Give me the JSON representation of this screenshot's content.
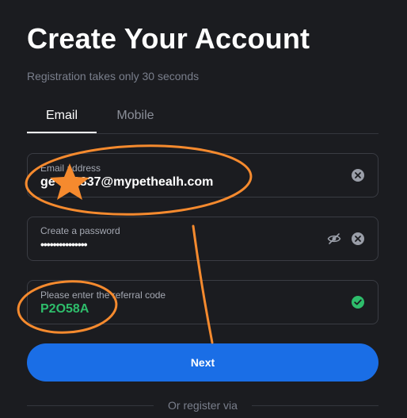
{
  "header": {
    "title": "Create Your Account",
    "subtitle": "Registration takes only 30 seconds"
  },
  "tabs": [
    {
      "label": "Email",
      "active": true
    },
    {
      "label": "Mobile",
      "active": false
    }
  ],
  "form": {
    "email": {
      "label": "Email address",
      "value": "ge     0837@mypethealh.com"
    },
    "password": {
      "label": "Create a password",
      "value": "•••••••••••••••"
    },
    "referral": {
      "label": "Please enter the referral code",
      "value": "P2O58A"
    },
    "next_label": "Next"
  },
  "footer": {
    "divider_text": "Or register via"
  },
  "icons": {
    "clear": "clear-icon",
    "eye_hidden": "eye-slash-icon",
    "verified": "check-circle-icon"
  },
  "colors": {
    "background": "#1b1c20",
    "primary_button": "#1a6ee6",
    "success": "#2ebd6b",
    "annotation": "#f58a2e"
  }
}
